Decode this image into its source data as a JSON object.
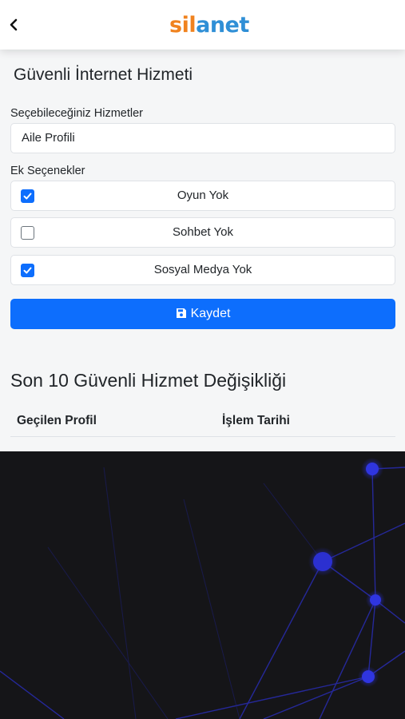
{
  "header": {
    "back_icon": "chevron-left-icon",
    "logo_part1": "sil",
    "logo_part2": "anet"
  },
  "form": {
    "title": "Güvenli İnternet Hizmeti",
    "services_label": "Seçebileceğiniz Hizmetler",
    "service_selected": "Aile Profili",
    "extras_label": "Ek Seçenekler",
    "options": [
      {
        "label": "Oyun Yok",
        "checked": true
      },
      {
        "label": "Sohbet Yok",
        "checked": false
      },
      {
        "label": "Sosyal Medya Yok",
        "checked": true
      }
    ],
    "save_label": "Kaydet",
    "save_icon": "floppy-disk-icon",
    "accent_color": "#0d6efd"
  },
  "history": {
    "title": "Son 10 Güvenli Hizmet Değişikliği",
    "columns": [
      "Geçilen Profil",
      "İşlem Tarihi"
    ],
    "rows": []
  }
}
